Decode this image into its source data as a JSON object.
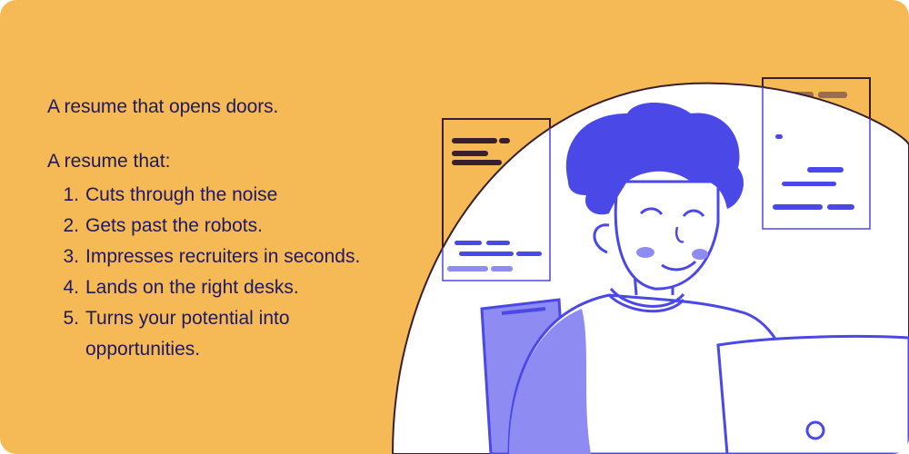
{
  "headline": "A resume that opens doors.",
  "intro": "A resume that:",
  "points": [
    {
      "num": "1.",
      "text": "Cuts through the noise"
    },
    {
      "num": "2.",
      "text": "Gets past the robots."
    },
    {
      "num": "3.",
      "text": "Impresses recruiters in seconds."
    },
    {
      "num": "4.",
      "text": "Lands on the right desks."
    },
    {
      "num": "5.",
      "text": "Turns your potential into opportunities."
    }
  ],
  "colors": {
    "background": "#F5B955",
    "text": "#1F1A5E",
    "accent": "#4B48E8",
    "accent_light": "#8E8CF2",
    "outline": "#3A1E2E"
  },
  "illustration": {
    "icon": "person-at-laptop-illustration"
  }
}
